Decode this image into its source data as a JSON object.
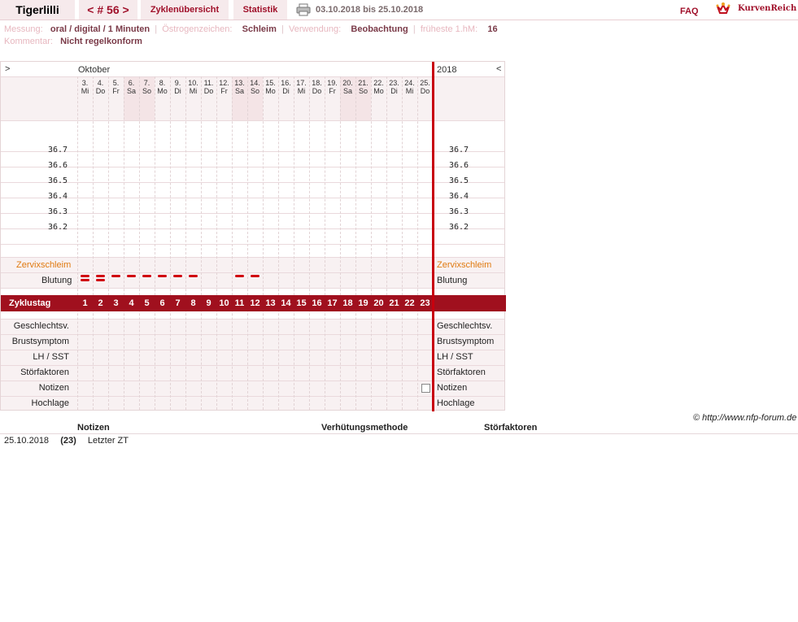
{
  "topbar": {
    "name": "Tigerlilli",
    "cycle": "< # 56 >",
    "overview": "Zyklenübersicht",
    "stats": "Statistik",
    "date_range": "03.10.2018 bis 25.10.2018",
    "faq": "FAQ",
    "brand": "KurvenReich"
  },
  "info": {
    "messung_label": "Messung:",
    "messung": "oral / digital / 1 Minuten",
    "oestrogen_label": "Östrogenzeichen:",
    "oestrogen": "Schleim",
    "verwendung_label": "Verwendung:",
    "verwendung": "Beobachtung",
    "hm_label": "früheste 1.hM:",
    "hm": "16",
    "kommentar_label": "Kommentar:",
    "kommentar": "Nicht regelkonform"
  },
  "chart": {
    "nav_left": ">",
    "nav_right": "<",
    "month": "Oktober",
    "year": "2018",
    "days": [
      {
        "d": "3.",
        "w": "Mi",
        "we": false
      },
      {
        "d": "4.",
        "w": "Do",
        "we": false
      },
      {
        "d": "5.",
        "w": "Fr",
        "we": false
      },
      {
        "d": "6.",
        "w": "Sa",
        "we": true
      },
      {
        "d": "7.",
        "w": "So",
        "we": true
      },
      {
        "d": "8.",
        "w": "Mo",
        "we": false
      },
      {
        "d": "9.",
        "w": "Di",
        "we": false
      },
      {
        "d": "10.",
        "w": "Mi",
        "we": false
      },
      {
        "d": "11.",
        "w": "Do",
        "we": false
      },
      {
        "d": "12.",
        "w": "Fr",
        "we": false
      },
      {
        "d": "13.",
        "w": "Sa",
        "we": true
      },
      {
        "d": "14.",
        "w": "So",
        "we": true
      },
      {
        "d": "15.",
        "w": "Mo",
        "we": false
      },
      {
        "d": "16.",
        "w": "Di",
        "we": false
      },
      {
        "d": "17.",
        "w": "Mi",
        "we": false
      },
      {
        "d": "18.",
        "w": "Do",
        "we": false
      },
      {
        "d": "19.",
        "w": "Fr",
        "we": false
      },
      {
        "d": "20.",
        "w": "Sa",
        "we": true
      },
      {
        "d": "21.",
        "w": "So",
        "we": true
      },
      {
        "d": "22.",
        "w": "Mo",
        "we": false
      },
      {
        "d": "23.",
        "w": "Di",
        "we": false
      },
      {
        "d": "24.",
        "w": "Mi",
        "we": false
      },
      {
        "d": "25.",
        "w": "Do",
        "we": false
      }
    ],
    "temps": [
      "36.7",
      "36.6",
      "36.5",
      "36.4",
      "36.3",
      "36.2"
    ],
    "bleeding": [
      2,
      2,
      1,
      1,
      1,
      1,
      1,
      1,
      0,
      0,
      1,
      1,
      0,
      0,
      0,
      0,
      0,
      0,
      0,
      0,
      0,
      0,
      0
    ],
    "zervix_label": "Zervixschleim",
    "blutung_label": "Blutung",
    "zyklustag_label": "Zyklustag",
    "zyklustage": [
      "1",
      "2",
      "3",
      "4",
      "5",
      "6",
      "7",
      "8",
      "9",
      "10",
      "11",
      "12",
      "13",
      "14",
      "15",
      "16",
      "17",
      "18",
      "19",
      "20",
      "21",
      "22",
      "23"
    ],
    "bottom_rows": [
      "Geschlechtsv.",
      "Brustsymptom",
      "LH / SST",
      "Störfaktoren",
      "Notizen",
      "Hochlage"
    ],
    "colors": {
      "accent": "#a0101e",
      "zervix": "#e07a10",
      "bleed": "#d00010"
    }
  },
  "footer": {
    "copyright": "© http://www.nfp-forum.de",
    "col_notes": "Notizen",
    "col_method": "Verhütungsmethode",
    "col_stoer": "Störfaktoren",
    "row_date": "25.10.2018",
    "row_day": "(23)",
    "row_note": "Letzter ZT"
  }
}
